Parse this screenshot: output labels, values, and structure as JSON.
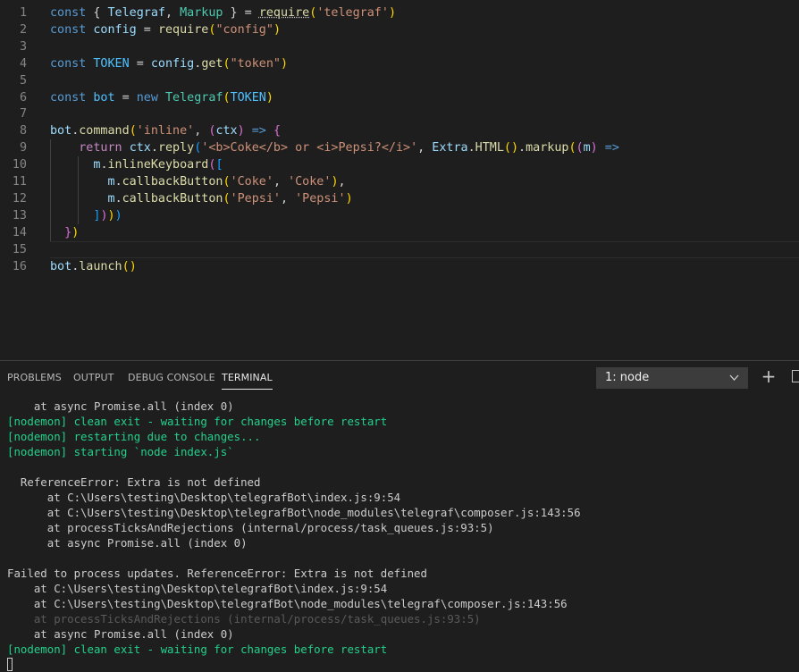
{
  "editor": {
    "line_numbers": [
      "1",
      "2",
      "3",
      "4",
      "5",
      "6",
      "7",
      "8",
      "9",
      "10",
      "11",
      "12",
      "13",
      "14",
      "15",
      "16"
    ],
    "lines": [
      [
        {
          "t": "const",
          "c": "kw"
        },
        {
          "t": " { ",
          "c": "op"
        },
        {
          "t": "Telegraf",
          "c": "var"
        },
        {
          "t": ", ",
          "c": "op"
        },
        {
          "t": "Markup",
          "c": "cls"
        },
        {
          "t": " } = ",
          "c": "op"
        },
        {
          "t": "require",
          "c": "fn squig"
        },
        {
          "t": "(",
          "c": "b1"
        },
        {
          "t": "'telegraf'",
          "c": "str"
        },
        {
          "t": ")",
          "c": "b1"
        }
      ],
      [
        {
          "t": "const",
          "c": "kw"
        },
        {
          "t": " ",
          "c": "op"
        },
        {
          "t": "config",
          "c": "var"
        },
        {
          "t": " = ",
          "c": "op"
        },
        {
          "t": "require",
          "c": "fn"
        },
        {
          "t": "(",
          "c": "b1"
        },
        {
          "t": "\"config\"",
          "c": "str"
        },
        {
          "t": ")",
          "c": "b1"
        }
      ],
      [],
      [
        {
          "t": "const",
          "c": "kw"
        },
        {
          "t": " ",
          "c": "op"
        },
        {
          "t": "TOKEN",
          "c": "const"
        },
        {
          "t": " = ",
          "c": "op"
        },
        {
          "t": "config",
          "c": "var"
        },
        {
          "t": ".",
          "c": "op"
        },
        {
          "t": "get",
          "c": "fn"
        },
        {
          "t": "(",
          "c": "b1"
        },
        {
          "t": "\"token\"",
          "c": "str"
        },
        {
          "t": ")",
          "c": "b1"
        }
      ],
      [],
      [
        {
          "t": "const",
          "c": "kw"
        },
        {
          "t": " ",
          "c": "op"
        },
        {
          "t": "bot",
          "c": "const"
        },
        {
          "t": " = ",
          "c": "op"
        },
        {
          "t": "new",
          "c": "kw"
        },
        {
          "t": " ",
          "c": "op"
        },
        {
          "t": "Telegraf",
          "c": "cls"
        },
        {
          "t": "(",
          "c": "b1"
        },
        {
          "t": "TOKEN",
          "c": "const"
        },
        {
          "t": ")",
          "c": "b1"
        }
      ],
      [],
      [
        {
          "t": "bot",
          "c": "var"
        },
        {
          "t": ".",
          "c": "op"
        },
        {
          "t": "command",
          "c": "fn"
        },
        {
          "t": "(",
          "c": "b1"
        },
        {
          "t": "'inline'",
          "c": "str"
        },
        {
          "t": ", ",
          "c": "op"
        },
        {
          "t": "(",
          "c": "b2"
        },
        {
          "t": "ctx",
          "c": "var"
        },
        {
          "t": ")",
          "c": "b2"
        },
        {
          "t": " ",
          "c": "op"
        },
        {
          "t": "=>",
          "c": "kw"
        },
        {
          "t": " ",
          "c": "op"
        },
        {
          "t": "{",
          "c": "b2"
        }
      ],
      [
        {
          "t": "    ",
          "c": "op"
        },
        {
          "t": "return",
          "c": "kc"
        },
        {
          "t": " ",
          "c": "op"
        },
        {
          "t": "ctx",
          "c": "var"
        },
        {
          "t": ".",
          "c": "op"
        },
        {
          "t": "reply",
          "c": "fn"
        },
        {
          "t": "(",
          "c": "b3"
        },
        {
          "t": "'<b>Coke</b> or <i>Pepsi?</i>'",
          "c": "str"
        },
        {
          "t": ", ",
          "c": "op"
        },
        {
          "t": "Extra",
          "c": "var"
        },
        {
          "t": ".",
          "c": "op"
        },
        {
          "t": "HTML",
          "c": "fn"
        },
        {
          "t": "(",
          "c": "b1"
        },
        {
          "t": ")",
          "c": "b1"
        },
        {
          "t": ".",
          "c": "op"
        },
        {
          "t": "markup",
          "c": "fn"
        },
        {
          "t": "(",
          "c": "b1"
        },
        {
          "t": "(",
          "c": "b2"
        },
        {
          "t": "m",
          "c": "var"
        },
        {
          "t": ")",
          "c": "b2"
        },
        {
          "t": " ",
          "c": "op"
        },
        {
          "t": "=>",
          "c": "kw"
        }
      ],
      [
        {
          "t": "      ",
          "c": "op"
        },
        {
          "t": "m",
          "c": "var"
        },
        {
          "t": ".",
          "c": "op"
        },
        {
          "t": "inlineKeyboard",
          "c": "fn"
        },
        {
          "t": "(",
          "c": "b2"
        },
        {
          "t": "[",
          "c": "b3"
        }
      ],
      [
        {
          "t": "        ",
          "c": "op"
        },
        {
          "t": "m",
          "c": "var"
        },
        {
          "t": ".",
          "c": "op"
        },
        {
          "t": "callbackButton",
          "c": "fn"
        },
        {
          "t": "(",
          "c": "b1"
        },
        {
          "t": "'Coke'",
          "c": "str"
        },
        {
          "t": ", ",
          "c": "op"
        },
        {
          "t": "'Coke'",
          "c": "str"
        },
        {
          "t": ")",
          "c": "b1"
        },
        {
          "t": ",",
          "c": "op"
        }
      ],
      [
        {
          "t": "        ",
          "c": "op"
        },
        {
          "t": "m",
          "c": "var"
        },
        {
          "t": ".",
          "c": "op"
        },
        {
          "t": "callbackButton",
          "c": "fn"
        },
        {
          "t": "(",
          "c": "b1"
        },
        {
          "t": "'Pepsi'",
          "c": "str"
        },
        {
          "t": ", ",
          "c": "op"
        },
        {
          "t": "'Pepsi'",
          "c": "str"
        },
        {
          "t": ")",
          "c": "b1"
        }
      ],
      [
        {
          "t": "      ",
          "c": "op"
        },
        {
          "t": "]",
          "c": "b3"
        },
        {
          "t": ")",
          "c": "b2"
        },
        {
          "t": ")",
          "c": "b1"
        },
        {
          "t": ")",
          "c": "b3"
        }
      ],
      [
        {
          "t": "  ",
          "c": "op"
        },
        {
          "t": "}",
          "c": "b2"
        },
        {
          "t": ")",
          "c": "b1"
        }
      ],
      [],
      [
        {
          "t": "bot",
          "c": "var"
        },
        {
          "t": ".",
          "c": "op"
        },
        {
          "t": "launch",
          "c": "fn"
        },
        {
          "t": "(",
          "c": "b1"
        },
        {
          "t": ")",
          "c": "b1"
        }
      ]
    ]
  },
  "panel": {
    "tabs": [
      {
        "label": "PROBLEMS",
        "name": "tab-problems",
        "active": false
      },
      {
        "label": "OUTPUT",
        "name": "tab-output",
        "active": false
      },
      {
        "label": "DEBUG CONSOLE",
        "name": "tab-debug-console",
        "active": false
      },
      {
        "label": "TERMINAL",
        "name": "tab-terminal",
        "active": true
      }
    ],
    "terminal_select": "1: node",
    "new_terminal_glyph": "+",
    "icons": {
      "dropdown": "chevron-down-icon",
      "new_terminal": "plus-icon",
      "split": "split-terminal-icon"
    }
  },
  "terminal": {
    "lines": [
      {
        "text": "    at async Promise.all (index 0)",
        "style": "normal"
      },
      {
        "text": "[nodemon] clean exit - waiting for changes before restart",
        "style": "green"
      },
      {
        "text": "[nodemon] restarting due to changes...",
        "style": "green"
      },
      {
        "text": "[nodemon] starting `node index.js`",
        "style": "green"
      },
      {
        "text": "",
        "style": "normal"
      },
      {
        "text": "  ReferenceError: Extra is not defined",
        "style": "normal"
      },
      {
        "text": "      at C:\\Users\\testing\\Desktop\\telegrafBot\\index.js:9:54",
        "style": "normal"
      },
      {
        "text": "      at C:\\Users\\testing\\Desktop\\telegrafBot\\node_modules\\telegraf\\composer.js:143:56",
        "style": "normal"
      },
      {
        "text": "      at processTicksAndRejections (internal/process/task_queues.js:93:5)",
        "style": "normal"
      },
      {
        "text": "      at async Promise.all (index 0)",
        "style": "normal"
      },
      {
        "text": "",
        "style": "normal"
      },
      {
        "text": "Failed to process updates. ReferenceError: Extra is not defined",
        "style": "normal"
      },
      {
        "text": "    at C:\\Users\\testing\\Desktop\\telegrafBot\\index.js:9:54",
        "style": "normal"
      },
      {
        "text": "    at C:\\Users\\testing\\Desktop\\telegrafBot\\node_modules\\telegraf\\composer.js:143:56",
        "style": "normal"
      },
      {
        "text": "    at processTicksAndRejections (internal/process/task_queues.js:93:5)",
        "style": "gray"
      },
      {
        "text": "    at async Promise.all (index 0)",
        "style": "normal"
      },
      {
        "text": "[nodemon] clean exit - waiting for changes before restart",
        "style": "green"
      }
    ]
  },
  "colors": {
    "background": "#1e1e1e",
    "keyword": "#569cd6",
    "string": "#ce9178",
    "function": "#dcdcaa",
    "variable": "#9cdcfe",
    "terminal_green": "#23d18b"
  }
}
